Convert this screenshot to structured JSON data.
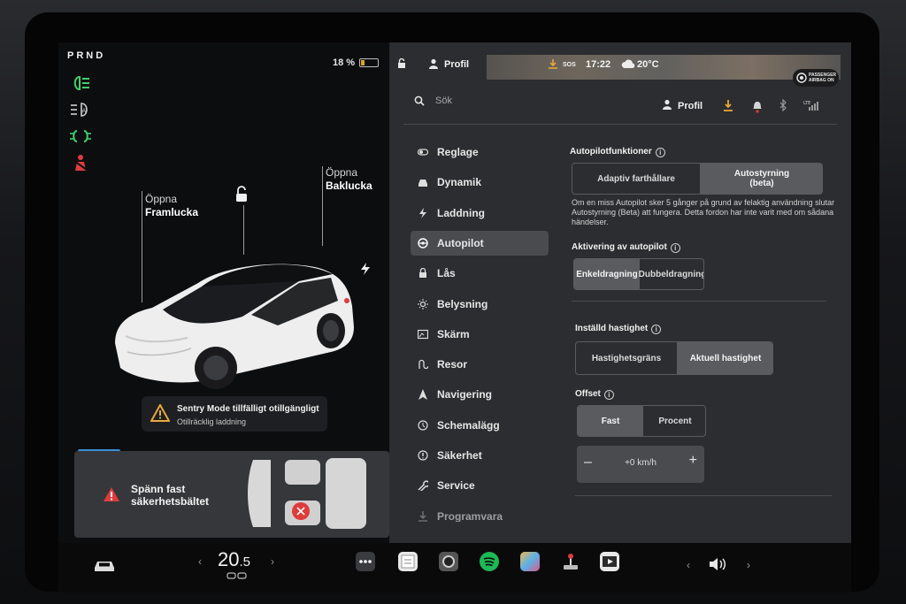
{
  "gear": "PRND",
  "battery": {
    "percent": "18 %",
    "level": 0.18,
    "color": "#d8a52a"
  },
  "car_panel": {
    "frunk": {
      "line1": "Öppna",
      "line2": "Framlucka"
    },
    "trunk": {
      "line1": "Öppna",
      "line2": "Baklucka"
    },
    "indicators": [
      "headlight-icon",
      "auto-headlight-icon",
      "parking-light-icon",
      "seatbelt-warning-icon"
    ],
    "sentry": {
      "title": "Sentry Mode tillfälligt otillgängligt",
      "subtitle": "Otillräcklig laddning"
    },
    "belt_alert": {
      "line1": "Spänn fast",
      "line2": "säkerhetsbältet"
    }
  },
  "status_bar": {
    "profile": "Profil",
    "sos": "SOS",
    "time": "17:22",
    "temperature": "20°C",
    "airbag": {
      "line1": "PASSENGER",
      "line2": "AIRBAG ON"
    }
  },
  "header": {
    "search_placeholder": "Sök",
    "profile": "Profil"
  },
  "menu": [
    {
      "label": "Reglage",
      "icon": "toggle-icon"
    },
    {
      "label": "Dynamik",
      "icon": "car-icon"
    },
    {
      "label": "Laddning",
      "icon": "bolt-icon"
    },
    {
      "label": "Autopilot",
      "icon": "steering-wheel-icon",
      "active": true
    },
    {
      "label": "Lås",
      "icon": "lock-icon"
    },
    {
      "label": "Belysning",
      "icon": "sun-icon"
    },
    {
      "label": "Skärm",
      "icon": "display-icon"
    },
    {
      "label": "Resor",
      "icon": "trips-icon"
    },
    {
      "label": "Navigering",
      "icon": "navigation-icon"
    },
    {
      "label": "Schemalägg",
      "icon": "clock-icon"
    },
    {
      "label": "Säkerhet",
      "icon": "safety-icon"
    },
    {
      "label": "Service",
      "icon": "wrench-icon"
    },
    {
      "label": "Programvara",
      "icon": "download-icon"
    }
  ],
  "autopilot": {
    "features_title": "Autopilotfunktioner",
    "features_options": [
      "Adaptiv farthållare",
      "Autostyrning (beta)"
    ],
    "features_selected": 1,
    "description": "Om en miss Autopilot sker 5 gånger på grund av felaktig användning slutar Autostyrning (Beta) att fungera. Detta fordon har inte varit med om sådana händelser.",
    "activation_title": "Aktivering av autopilot",
    "activation_options": [
      "Enkeldragning",
      "Dubbeldragning"
    ],
    "activation_selected": 0,
    "speed_title": "Inställd hastighet",
    "speed_options": [
      "Hastighetsgräns",
      "Aktuell hastighet"
    ],
    "speed_selected": 1,
    "offset_title": "Offset",
    "offset_options": [
      "Fast",
      "Procent"
    ],
    "offset_selected": 0,
    "offset_value": "+0 km/h",
    "offset_minus": "–",
    "offset_plus": "+"
  },
  "taskbar": {
    "temp_int": "20",
    "temp_dec": ".5",
    "apps": [
      "more-icon",
      "notes-icon",
      "camera-icon",
      "spotify-icon",
      "toybox-icon",
      "joystick-icon",
      "theater-icon"
    ]
  },
  "colors": {
    "accent_blue": "#3a8fd8",
    "warning_red": "#e03b3b",
    "green": "#3ecf6a"
  }
}
